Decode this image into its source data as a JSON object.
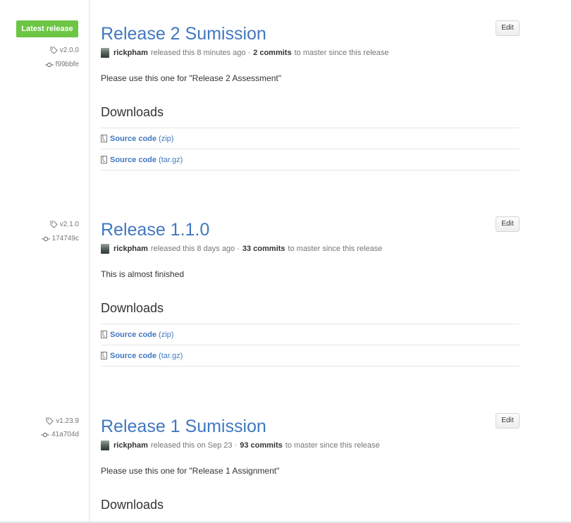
{
  "latest_badge": "Latest release",
  "edit_label": "Edit",
  "downloads_heading": "Downloads",
  "releases": [
    {
      "tag": "v2.0.0",
      "commit": "f99bbfe",
      "title": "Release 2 Sumission",
      "author": "rickpham",
      "released_text": "released this 8 minutes ago ·",
      "commits_count": "2 commits",
      "commits_suffix": "to master since this release",
      "description": "Please use this one for \"Release 2 Assessment\"",
      "assets": [
        {
          "name": "Source code",
          "ext": "(zip)"
        },
        {
          "name": "Source code",
          "ext": "(tar.gz)"
        }
      ]
    },
    {
      "tag": "v2.1.0",
      "commit": "174749c",
      "title": "Release 1.1.0",
      "author": "rickpham",
      "released_text": "released this 8 days ago ·",
      "commits_count": "33 commits",
      "commits_suffix": "to master since this release",
      "description": "This is almost finished",
      "assets": [
        {
          "name": "Source code",
          "ext": "(zip)"
        },
        {
          "name": "Source code",
          "ext": "(tar.gz)"
        }
      ]
    },
    {
      "tag": "v1.23.9",
      "commit": "41a704d",
      "title": "Release 1 Sumission",
      "author": "rickpham",
      "released_text": "released this on Sep 23 ·",
      "commits_count": "93 commits",
      "commits_suffix": "to master since this release",
      "description": "Please use this one for \"Release 1 Assignment\"",
      "assets": []
    }
  ],
  "colors": {
    "link": "#4078c0",
    "latest_badge_bg": "#6cc644",
    "muted_text": "#767676"
  },
  "icons": [
    "tag-icon",
    "git-commit-icon",
    "file-zip-icon",
    "avatar"
  ]
}
